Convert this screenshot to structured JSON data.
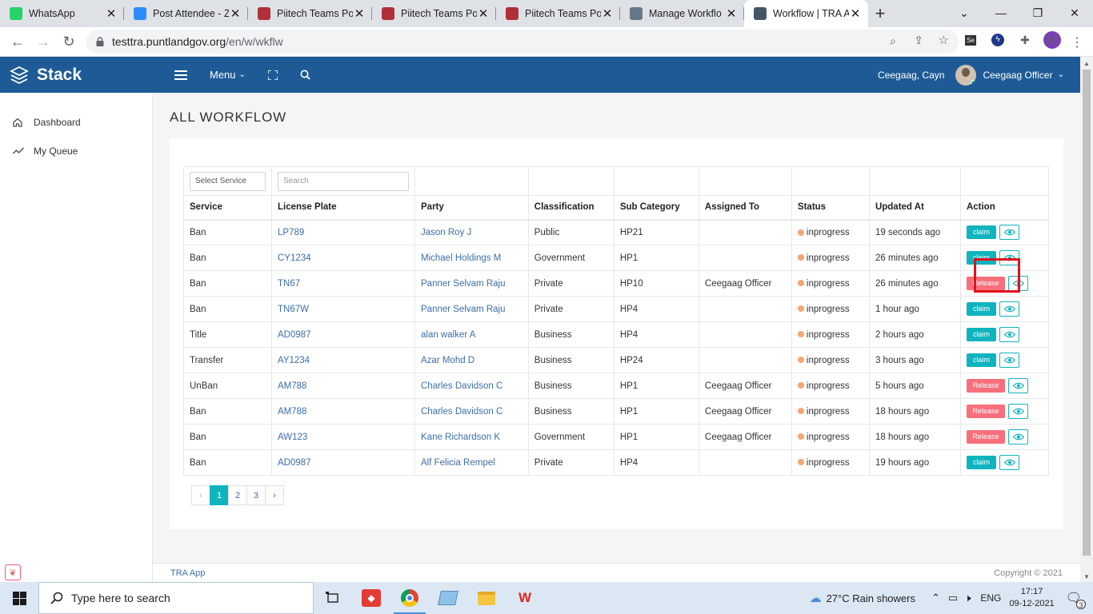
{
  "browser": {
    "tabs": [
      {
        "title": "WhatsApp",
        "icon": "whatsapp-icon",
        "color": "#25d366",
        "active": false
      },
      {
        "title": "Post Attendee - Z",
        "icon": "zoom-icon",
        "color": "#2d8cff",
        "active": false
      },
      {
        "title": "Piitech Teams Po",
        "icon": "teams-icon",
        "color": "#b0303a",
        "active": false
      },
      {
        "title": "Piitech Teams Po",
        "icon": "teams-icon",
        "color": "#b0303a",
        "active": false
      },
      {
        "title": "Piitech Teams Po",
        "icon": "teams-icon",
        "color": "#b0303a",
        "active": false
      },
      {
        "title": "Manage Workflo",
        "icon": "stack-icon",
        "color": "#667788",
        "active": false
      },
      {
        "title": "Workflow | TRA A",
        "icon": "stack-icon",
        "color": "#445566",
        "active": true
      }
    ],
    "url_host": "testtra.puntlandgov.org",
    "url_path": "/en/w/wkflw",
    "profile_initial": "M"
  },
  "header": {
    "brand": "Stack",
    "menu_label": "Menu",
    "user_name": "Ceegaag, Cayn",
    "user_role": "Ceegaag Officer"
  },
  "sidebar": {
    "items": [
      {
        "label": "Dashboard",
        "icon": "home-icon"
      },
      {
        "label": "My Queue",
        "icon": "trend-icon"
      }
    ]
  },
  "page": {
    "title": "ALL WORKFLOW",
    "filter_select": "Select Service",
    "search_placeholder": "Search"
  },
  "table": {
    "columns": [
      "Service",
      "License Plate",
      "Party",
      "Classification",
      "Sub Category",
      "Assigned To",
      "Status",
      "Updated At",
      "Action"
    ],
    "rows": [
      {
        "service": "Ban",
        "plate": "LP789",
        "party": "Jason Roy J",
        "classification": "Public",
        "subcat": "HP21",
        "assigned": "",
        "status": "inprogress",
        "updated": "19 seconds ago",
        "action": "claim"
      },
      {
        "service": "Ban",
        "plate": "CY1234",
        "party": "Michael Holdings M",
        "classification": "Government",
        "subcat": "HP1",
        "assigned": "",
        "status": "inprogress",
        "updated": "26 minutes ago",
        "action": "claim"
      },
      {
        "service": "Ban",
        "plate": "TN67",
        "party": "Panner Selvam Raju",
        "classification": "Private",
        "subcat": "HP10",
        "assigned": "Ceegaag Officer",
        "status": "inprogress",
        "updated": "26 minutes ago",
        "action": "Release"
      },
      {
        "service": "Ban",
        "plate": "TN67W",
        "party": "Panner Selvam Raju",
        "classification": "Private",
        "subcat": "HP4",
        "assigned": "",
        "status": "inprogress",
        "updated": "1 hour ago",
        "action": "claim"
      },
      {
        "service": "Title",
        "plate": "AD0987",
        "party": "alan walker A",
        "classification": "Business",
        "subcat": "HP4",
        "assigned": "",
        "status": "inprogress",
        "updated": "2 hours ago",
        "action": "claim"
      },
      {
        "service": "Transfer",
        "plate": "AY1234",
        "party": "Azar Mohd D",
        "classification": "Business",
        "subcat": "HP24",
        "assigned": "",
        "status": "inprogress",
        "updated": "3 hours ago",
        "action": "claim"
      },
      {
        "service": "UnBan",
        "plate": "AM788",
        "party": "Charles Davidson C",
        "classification": "Business",
        "subcat": "HP1",
        "assigned": "Ceegaag Officer",
        "status": "inprogress",
        "updated": "5 hours ago",
        "action": "Release"
      },
      {
        "service": "Ban",
        "plate": "AM788",
        "party": "Charles Davidson C",
        "classification": "Business",
        "subcat": "HP1",
        "assigned": "Ceegaag Officer",
        "status": "inprogress",
        "updated": "18 hours ago",
        "action": "Release"
      },
      {
        "service": "Ban",
        "plate": "AW123",
        "party": "Kane Richardson K",
        "classification": "Government",
        "subcat": "HP1",
        "assigned": "Ceegaag Officer",
        "status": "inprogress",
        "updated": "18 hours ago",
        "action": "Release"
      },
      {
        "service": "Ban",
        "plate": "AD0987",
        "party": "Alf Felicia Rempel",
        "classification": "Private",
        "subcat": "HP4",
        "assigned": "",
        "status": "inprogress",
        "updated": "19 hours ago",
        "action": "claim"
      }
    ]
  },
  "pagination": {
    "prev": "‹",
    "pages": [
      "1",
      "2",
      "3"
    ],
    "current": "1",
    "next": "›"
  },
  "footer": {
    "left": "TRA App",
    "right": "Copyright © 2021"
  },
  "taskbar": {
    "search_placeholder": "Type here to search",
    "weather": "27°C  Rain showers",
    "lang": "ENG",
    "time": "17:17",
    "date": "09-12-2021",
    "notifications": "3"
  },
  "colors": {
    "header": "#1e5b96",
    "claim": "#10b4be",
    "release": "#f76f7b",
    "status_dot": "#f7a572",
    "highlight": "#e0121c"
  }
}
